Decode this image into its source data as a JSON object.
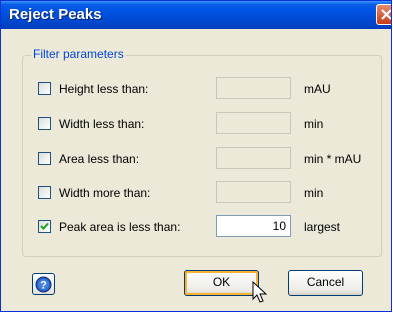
{
  "window": {
    "title": "Reject Peaks"
  },
  "group": {
    "legend": "Filter parameters"
  },
  "rows": [
    {
      "label": "Height less than:",
      "checked": false,
      "value": "",
      "unit": "mAU"
    },
    {
      "label": "Width less than:",
      "checked": false,
      "value": "",
      "unit": "min"
    },
    {
      "label": "Area less than:",
      "checked": false,
      "value": "",
      "unit": "min * mAU"
    },
    {
      "label": "Width more than:",
      "checked": false,
      "value": "",
      "unit": "min"
    },
    {
      "label": "Peak area is less than:",
      "checked": true,
      "value": "10",
      "unit": "largest"
    }
  ],
  "buttons": {
    "ok": "OK",
    "cancel": "Cancel"
  },
  "icons": {
    "help": "help-icon",
    "close": "close-icon",
    "cursor": "mouse-pointer-icon"
  },
  "colors": {
    "titlebar": "#0055e5",
    "window_bg": "#ece9d8",
    "legend_text": "#0046d5",
    "default_button_ring": "#f8b332"
  }
}
